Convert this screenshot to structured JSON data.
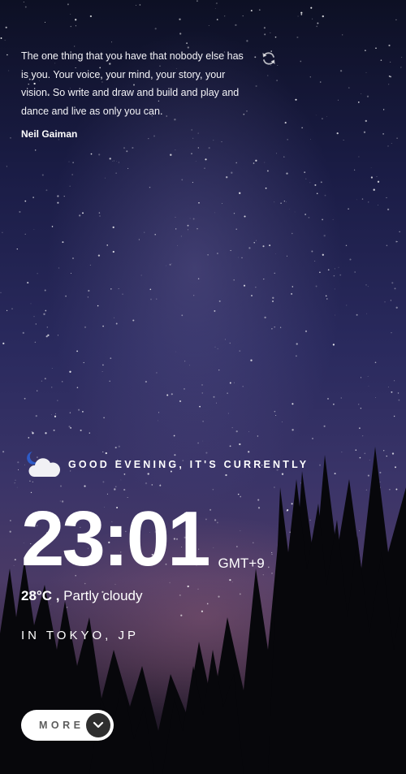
{
  "quote": {
    "text": "The one thing that you have that nobody else has is you. Your voice, your mind, your story, your vision. So write and draw and build and play and dance and live as only you can.",
    "author": "Neil Gaiman",
    "refresh_icon": "refresh-icon"
  },
  "greeting": {
    "icon": "moon-cloud-icon",
    "text": "GOOD EVENING, IT'S CURRENTLY"
  },
  "clock": {
    "time": "23:01",
    "timezone": "GMT+9"
  },
  "weather": {
    "temperature": "28°C ,",
    "condition": "Partly cloudy"
  },
  "location": {
    "text": "IN TOKYO, JP"
  },
  "more_button": {
    "label": "MORE",
    "icon": "chevron-down-icon"
  },
  "colors": {
    "text": "#ffffff",
    "button_bg": "#ffffff",
    "button_text": "#5c5c5c",
    "chevron_bg": "#2f2f2f"
  }
}
